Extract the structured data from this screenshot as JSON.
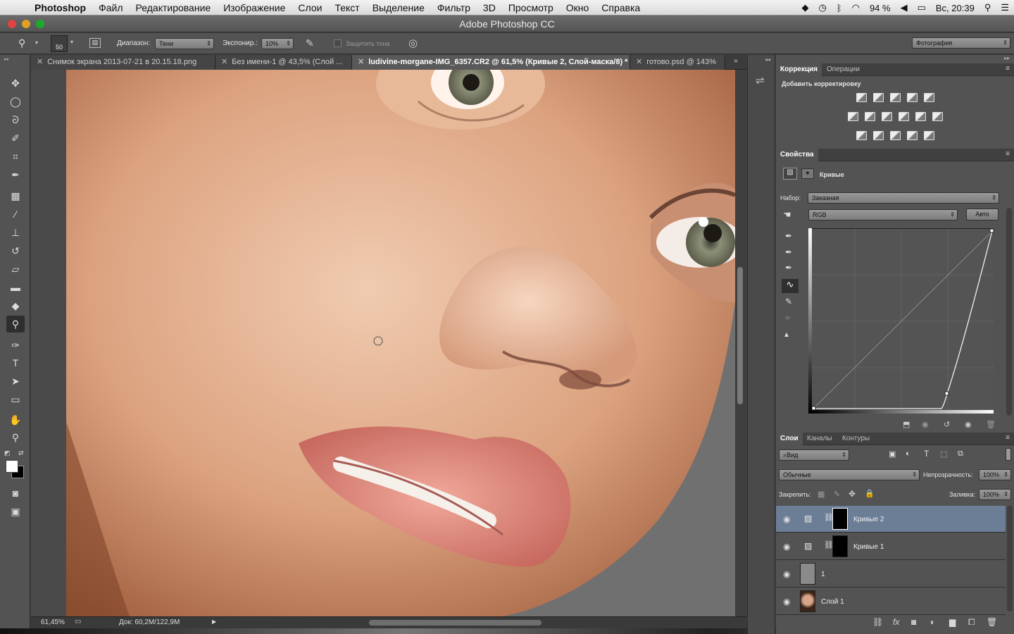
{
  "menubar": {
    "app": "Photoshop",
    "items": [
      "Файл",
      "Редактирование",
      "Изображение",
      "Слои",
      "Текст",
      "Выделение",
      "Фильтр",
      "3D",
      "Просмотр",
      "Окно",
      "Справка"
    ],
    "battery": "94 %",
    "clock": "Вс, 20:39"
  },
  "window": {
    "title": "Adobe Photoshop CC"
  },
  "options": {
    "brush_size": "50",
    "range_label": "Диапазон:",
    "range_value": "Тени",
    "exposure_label": "Экспонир.:",
    "exposure_value": "10%",
    "protect_tones": "Защитить тона",
    "workspace": "Фотография"
  },
  "doc_tabs": [
    {
      "label": "Снимок экрана 2013-07-21 в 20.15.18.png"
    },
    {
      "label": "Без имени-1 @ 43,5% (Слой ..."
    },
    {
      "label": "ludivine-morgane-IMG_6357.CR2 @ 61,5% (Кривые 2, Слой-маска/8) *"
    },
    {
      "label": "готово.psd @ 143%"
    }
  ],
  "status": {
    "zoom": "61,45%",
    "doc": "Док: 60,2M/122,9M"
  },
  "adjustments": {
    "tabs": [
      "Коррекция",
      "Операции"
    ],
    "heading": "Добавить корректировку"
  },
  "properties": {
    "tab": "Свойства",
    "title": "Кривые",
    "preset_label": "Набор:",
    "preset_value": "Заказная",
    "channel": "RGB",
    "auto": "Авто"
  },
  "layers_panel": {
    "tabs": [
      "Слои",
      "Каналы",
      "Контуры"
    ],
    "filter": "Вид",
    "blend_mode": "Обычные",
    "opacity_label": "Непрозрачность:",
    "opacity_value": "100%",
    "lock_label": "Закрепить:",
    "fill_label": "Заливка:",
    "fill_value": "100%",
    "layers": [
      {
        "name": "Кривые 2"
      },
      {
        "name": "Кривые 1"
      },
      {
        "name": "1"
      },
      {
        "name": "Слой 1"
      }
    ]
  }
}
